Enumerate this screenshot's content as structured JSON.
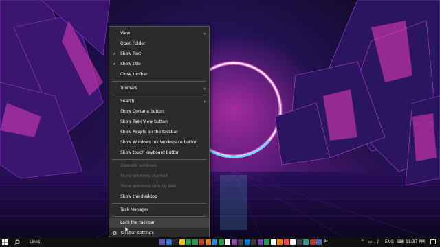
{
  "context_menu": {
    "items": [
      {
        "label": "View",
        "arrow": "›"
      },
      {
        "label": "Open Folder"
      },
      {
        "label": "Show Text",
        "check": "✓"
      },
      {
        "label": "Show title",
        "check": "✓"
      },
      {
        "label": "Close toolbar"
      },
      {
        "label": "Toolbars",
        "arrow": "›"
      },
      {
        "label": "Search",
        "arrow": "›"
      },
      {
        "label": "Show Cortana button"
      },
      {
        "label": "Show Task View button"
      },
      {
        "label": "Show People on the taskbar"
      },
      {
        "label": "Show Windows Ink Workspace button"
      },
      {
        "label": "Show touch keyboard button"
      },
      {
        "label": "Cascade windows",
        "disabled": true
      },
      {
        "label": "Show windows stacked",
        "disabled": true
      },
      {
        "label": "Show windows side by side",
        "disabled": true
      },
      {
        "label": "Show the desktop"
      },
      {
        "label": "Task Manager"
      },
      {
        "label": "Lock the taskbar",
        "hover": true
      },
      {
        "label": "Taskbar settings",
        "icon": "gear-icon"
      }
    ]
  },
  "taskbar": {
    "search_icon": "search-icon",
    "links_label": "Links",
    "tray_text": "Pr",
    "language": "ENG",
    "time": "11:37 PM",
    "start_icon": "windows-start-icon",
    "notifications_icon": "notifications-icon",
    "pinned_app_colors": [
      "#6a4ec6",
      "#2f7bd6",
      "#2a2a2a",
      "#f2c40f",
      "#1e9e4a",
      "#1e9e4a",
      "#c0392b",
      "#e67e22",
      "#2e86de",
      "#1e9e4a",
      "#ffffff",
      "#8e44ad",
      "#444444",
      "#0078d4",
      "#3a3a3a",
      "#7a3bb8",
      "#1e9e4a",
      "#ffffff",
      "#ff7a00",
      "#e44",
      "#ffffff",
      "#444444",
      "#2a9d8f",
      "#c0392b",
      "#4b6cb7"
    ]
  }
}
